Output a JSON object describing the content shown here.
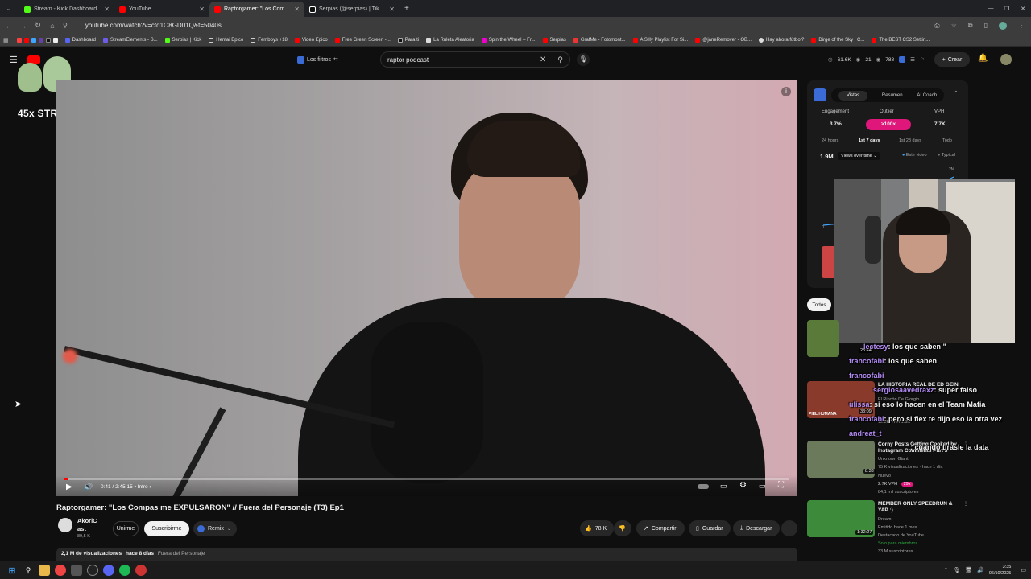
{
  "browser": {
    "tabs": [
      {
        "title": "Stream - Kick Dashboard",
        "color": "#53fc18",
        "active": false
      },
      {
        "title": "YouTube",
        "color": "#ff0000",
        "active": false
      },
      {
        "title": "Raptorgamer: \"Los Compas me",
        "color": "#ff0000",
        "active": true
      },
      {
        "title": "Serpias (@serpias) | TikTok",
        "color": "#ffffff",
        "active": false
      }
    ],
    "url": "youtube.com/watch?v=ctd1O8GD01Q&t=5040s",
    "bookmarks": [
      "Dashboard",
      "StreamElements - S...",
      "Serpias | Kick",
      "Hentai Epico",
      "Femboys +18",
      "Video Epico",
      "Free Green Screen -...",
      "Para ti",
      "La Ruleta Aleatoria",
      "Spin the Wheel – Fr...",
      "Serpias",
      "GrafMe - Fotomont...",
      "A Silly Playlist For Si...",
      "@janeRemover - OB...",
      "Hay ahora fútbol?",
      "Dirge of the Sky | C...",
      "The BEST CS2 Settin..."
    ]
  },
  "header": {
    "filters_label": "Los filtros",
    "search_value": "raptor podcast",
    "stats": {
      "likes": "61.6K",
      "count": "21",
      "views": "788"
    },
    "create_label": "Crear"
  },
  "overlay": {
    "streak": "45x STREAK"
  },
  "player": {
    "time": "0:41 / 2:45:15",
    "chapter": "Intro",
    "progress": 0.004
  },
  "video": {
    "title": "Raptorgamer: \"Los Compas me EXPULSARON\" // Fuera del Personaje (T3) Ep1",
    "channel_line1": "AkoriC",
    "channel_line2": "ast",
    "subs": "89,5 K",
    "join_label": "Unirme",
    "subscribe_label": "Suscribirme",
    "remix_label": "Remix",
    "likes": "78 K",
    "share_label": "Compartir",
    "save_label": "Guardar",
    "download_label": "Descargar",
    "views_line": "2,1 M de visualizaciones",
    "age": "hace 8 días",
    "playlist": "Fuera del Personaje"
  },
  "sidebar": {
    "tabs": [
      "Vistas",
      "Resumen",
      "AI Coach"
    ],
    "engagement_label": "Engagement",
    "engagement_value": "3.7%",
    "outlier_label": "Outlier",
    "outlier_value": ">100x",
    "vph_label": "VPH",
    "vph_value": "7.7K",
    "ranges": [
      "24 hours",
      "1st 7 days",
      "1st 28 days",
      "Todo"
    ],
    "total": "1.9M",
    "metric_select": "Views over time",
    "legend_this": "Este video",
    "legend_typical": "Typical",
    "axis_top": "2M",
    "axis_zero": "0",
    "todos": "Todos"
  },
  "recs": [
    {
      "title": "",
      "duration": "28:44",
      "channel": "",
      "meta": "",
      "color": "#5a7a3a"
    },
    {
      "title": "LA HISTORIA REAL DE ED GEIN",
      "duration": "33:09",
      "channel": "El Rincón De Giorgio",
      "meta": "1.5K",
      "vph": "12.3K VPH",
      "thumb_text": "PIEL HUMANA",
      "color": "#8a3a2a"
    },
    {
      "title": "Corny Posts Getting Cooked by Instagram Comments Part 3",
      "duration": "8:33",
      "channel": "Unknown Giant",
      "meta": "75 K visualizaciones · hace 1 día",
      "badge": "Nuevo",
      "vph": "2.7K VPH",
      "outlier": "29x",
      "subs": "84,1 mil suscriptores",
      "color": "#6a7a5a"
    },
    {
      "title": "MEMBER ONLY SPEEDRUN & YAP :)",
      "duration": "1:32:27",
      "channel": "Dream",
      "meta": "Emitido hace 1 mes",
      "extra": "Destacado de YouTube",
      "members": "Solo para miembros",
      "subs": "33 M suscriptores",
      "color": "#3d8a3a"
    }
  ],
  "chat": [
    {
      "name": "lectesy",
      "msg": ": los que saben",
      "tail": "\""
    },
    {
      "name": "francofabi",
      "msg": ": los que saben"
    },
    {
      "name": "francofabi",
      "msg": ""
    },
    {
      "name": "sergiosaavedraxz",
      "msg": ": super falso"
    },
    {
      "name": "ulissa",
      "msg": ": si eso lo hacen en el Team Mafia"
    },
    {
      "name": "francofabi",
      "msg": ": pero si flex te dijo eso la otra vez"
    },
    {
      "name": "andreat_t",
      "msg": ""
    },
    {
      "name": "",
      "msg": ": cuando tirasle la data"
    }
  ],
  "taskbar": {
    "time": "3:35",
    "date": "06/10/2025"
  }
}
